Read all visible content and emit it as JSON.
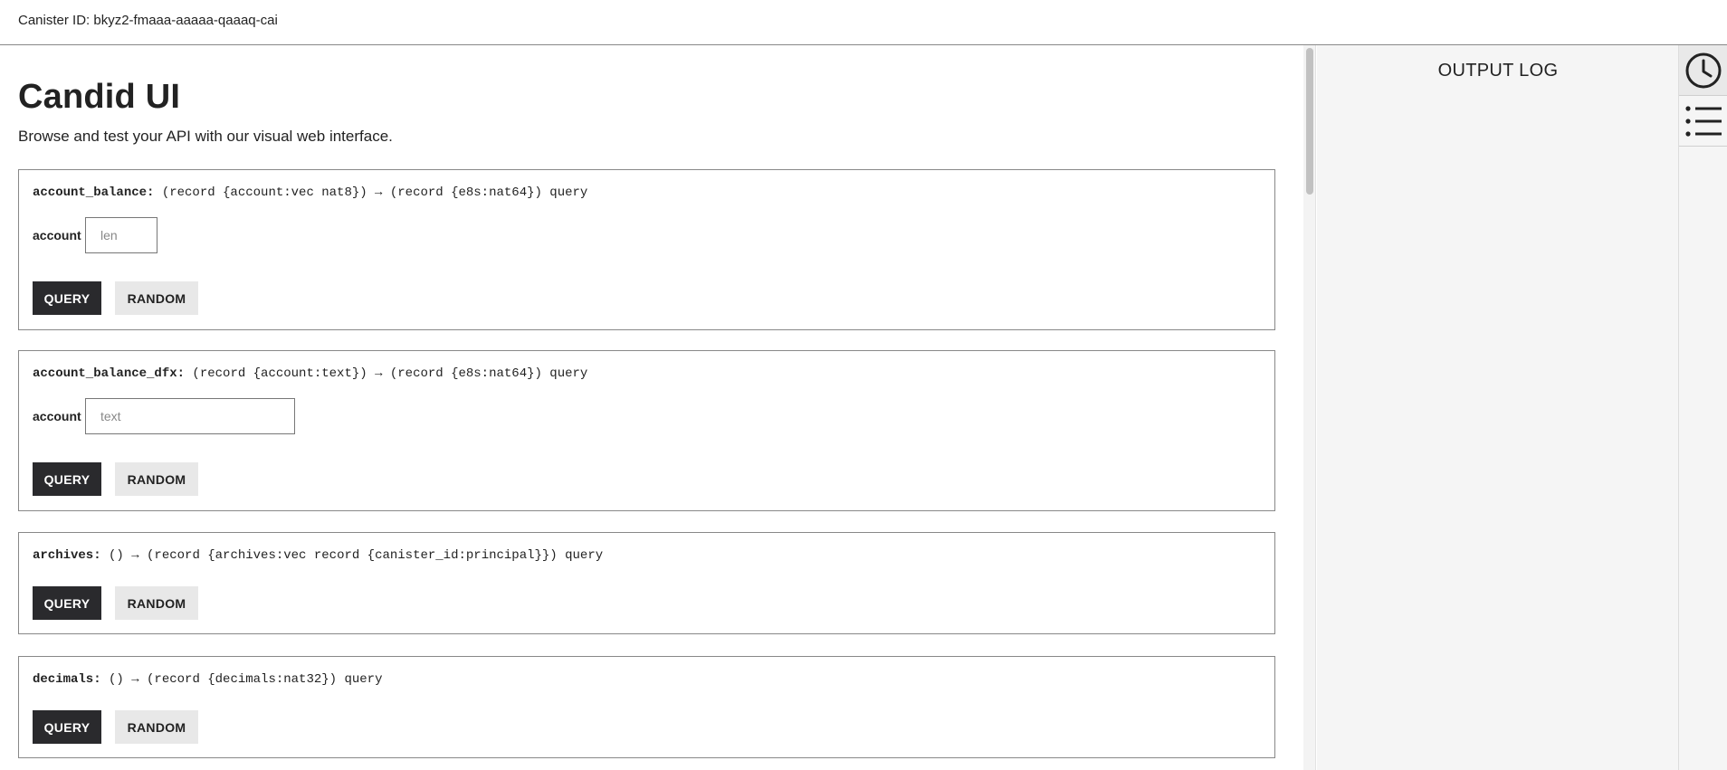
{
  "header": {
    "canister_id_text": "Canister ID: bkyz2-fmaaa-aaaaa-qaaaq-cai"
  },
  "main": {
    "title": "Candid UI",
    "subtitle": "Browse and test your API with our visual web interface."
  },
  "methods": [
    {
      "name": "account_balance:",
      "signature": " (record {account:vec nat8}) → (record {e8s:nat64}) query",
      "arg_label": "account",
      "arg_placeholder": "len",
      "query_label": "QUERY",
      "random_label": "RANDOM"
    },
    {
      "name": "account_balance_dfx:",
      "signature": " (record {account:text}) → (record {e8s:nat64}) query",
      "arg_label": "account",
      "arg_placeholder": "text",
      "query_label": "QUERY",
      "random_label": "RANDOM"
    },
    {
      "name": "archives:",
      "signature": " () → (record {archives:vec record {canister_id:principal}}) query",
      "query_label": "QUERY",
      "random_label": "RANDOM"
    },
    {
      "name": "decimals:",
      "signature": " () → (record {decimals:nat32}) query",
      "query_label": "QUERY",
      "random_label": "RANDOM"
    }
  ],
  "output_log": {
    "heading": "OUTPUT LOG"
  },
  "rail": {
    "icons": [
      "clock-icon",
      "list-icon"
    ]
  },
  "colors": {
    "query_button_bg": "#2a2a2d",
    "random_button_bg": "#e8e8e8",
    "output_panel_bg": "#f5f5f5",
    "card_border": "#888888"
  }
}
